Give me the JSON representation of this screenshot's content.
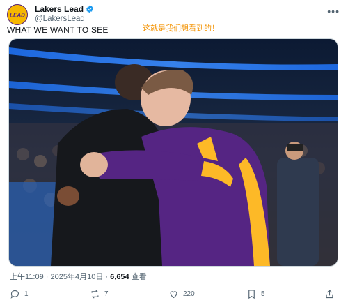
{
  "account": {
    "display_name": "Lakers Lead",
    "handle": "@LakersLead",
    "avatar_text": "LEAD",
    "verified_color": "#1d9bf0"
  },
  "tweet": {
    "text": "WHAT WE WANT TO SEE",
    "overlay_caption": "这就是我们想看到的！",
    "time": "上午11:09",
    "separator": "·",
    "date": "2025年4月10日",
    "views_count": "6,654",
    "views_label": "查看"
  },
  "actions": {
    "replies": "1",
    "reposts": "7",
    "likes": "220",
    "bookmarks": "5"
  },
  "colors": {
    "lakers_purple": "#552583",
    "lakers_gold": "#fdb927",
    "text_secondary": "#536471"
  }
}
